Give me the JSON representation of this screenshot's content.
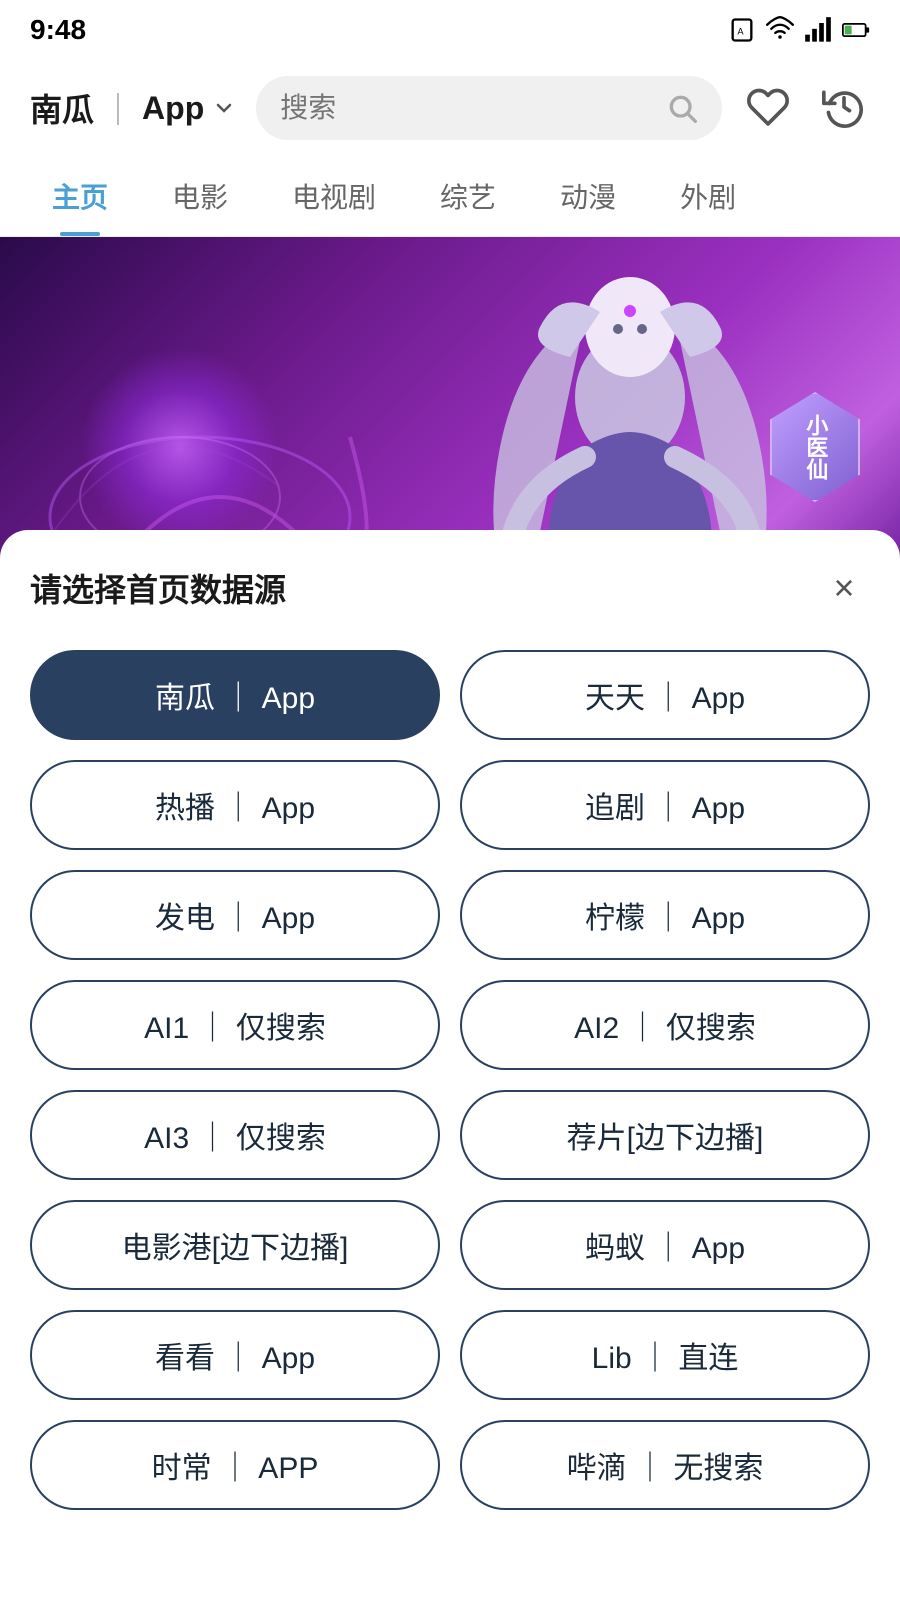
{
  "statusBar": {
    "time": "9:48",
    "icons": [
      "sim-icon",
      "wifi-icon",
      "signal-icon",
      "battery-icon"
    ]
  },
  "header": {
    "appName": "南瓜",
    "divider": "｜",
    "appLabel": "App",
    "chevronLabel": "下拉",
    "searchPlaceholder": "搜索",
    "favoriteLabel": "收藏",
    "historyLabel": "历史"
  },
  "navTabs": [
    {
      "label": "主页",
      "active": true
    },
    {
      "label": "电影",
      "active": false
    },
    {
      "label": "电视剧",
      "active": false
    },
    {
      "label": "综艺",
      "active": false
    },
    {
      "label": "动漫",
      "active": false
    },
    {
      "label": "外剧",
      "active": false
    }
  ],
  "banner": {
    "labelLine1": "小医",
    "labelLine2": "仙"
  },
  "modal": {
    "title": "请选择首页数据源",
    "closeLabel": "×",
    "sources": [
      {
        "id": "nangua",
        "label": "南瓜 ｜ App",
        "selected": true
      },
      {
        "id": "tiantian",
        "label": "天天 ｜ App",
        "selected": false
      },
      {
        "id": "rebo",
        "label": "热播 ｜ App",
        "selected": false
      },
      {
        "id": "zhuiju",
        "label": "追剧 ｜ App",
        "selected": false
      },
      {
        "id": "fadian",
        "label": "发电 ｜ App",
        "selected": false
      },
      {
        "id": "ningmeng",
        "label": "柠檬 ｜ App",
        "selected": false
      },
      {
        "id": "ai1",
        "label": "AI1 ｜ 仅搜索",
        "selected": false
      },
      {
        "id": "ai2",
        "label": "AI2 ｜ 仅搜索",
        "selected": false
      },
      {
        "id": "ai3",
        "label": "AI3 ｜ 仅搜索",
        "selected": false
      },
      {
        "id": "suipian",
        "label": "荐片[边下边播]",
        "selected": false
      },
      {
        "id": "dianyinggang",
        "label": "电影港[边下边播]",
        "selected": false
      },
      {
        "id": "mayi",
        "label": "蚂蚁 ｜ App",
        "selected": false
      },
      {
        "id": "kankan",
        "label": "看看 ｜ App",
        "selected": false
      },
      {
        "id": "lib",
        "label": "Lib ｜ 直连",
        "selected": false
      },
      {
        "id": "shichang",
        "label": "时常 ｜ APP",
        "selected": false
      },
      {
        "id": "pidi",
        "label": "哔滴 ｜ 无搜索",
        "selected": false
      }
    ]
  }
}
